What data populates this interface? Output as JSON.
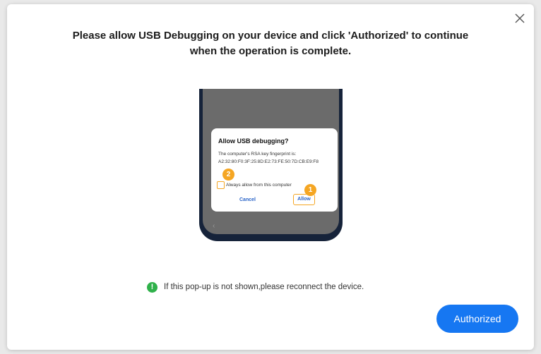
{
  "dialog": {
    "title_line1": "Please allow USB Debugging on your device and click 'Authorized' to continue",
    "title_line2": "when the operation is complete."
  },
  "phone_popup": {
    "title": "Allow USB debugging?",
    "fingerprint_label": "The computer's RSA key fingerprint is:",
    "fingerprint_value": "A2:32:80:F0:3F:25:8D:E2:73:FE:50:7D:CB:E9:F8",
    "checkbox_label": "Always allow from this computer",
    "cancel_label": "Cancel",
    "allow_label": "Allow",
    "step_1": "1",
    "step_2": "2"
  },
  "notice": {
    "icon": "!",
    "text": "If this pop-up is not shown,please reconnect the device."
  },
  "footer": {
    "authorized_label": "Authorized"
  },
  "colors": {
    "accent": "#1677f2",
    "highlight": "#f5a623",
    "notice_green": "#2fb14a"
  }
}
